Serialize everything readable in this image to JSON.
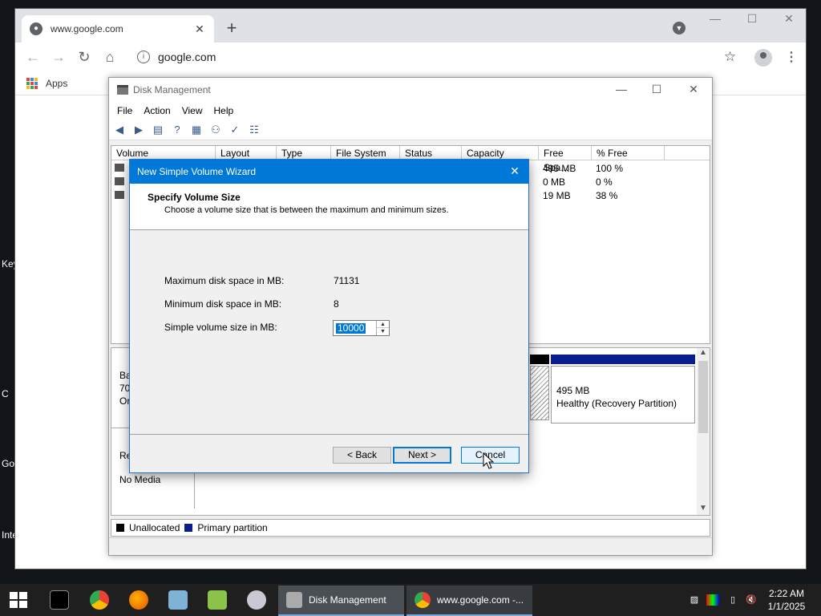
{
  "desktop": {
    "edge_labels": [
      "Key",
      "C",
      "Go",
      "Inte"
    ]
  },
  "browser": {
    "tab_title": "www.google.com",
    "url": "google.com",
    "bookmarks_label": "Apps",
    "icons": {
      "back": "back-arrow-icon",
      "forward": "forward-arrow-icon",
      "reload": "reload-icon",
      "home": "home-icon",
      "site_info": "info-icon",
      "bookmark": "star-icon",
      "profile": "avatar-icon",
      "menu": "kebab-menu-icon"
    }
  },
  "disk_mgmt": {
    "title": "Disk Management",
    "menu": [
      "File",
      "Action",
      "View",
      "Help"
    ],
    "columns": [
      "Volume",
      "Layout",
      "Type",
      "File System",
      "Status",
      "Capacity",
      "Free Spa...",
      "% Free"
    ],
    "rows": [
      {
        "free": "495 MB",
        "pct": "100 %"
      },
      {
        "free": "0 MB",
        "pct": "0 %"
      },
      {
        "free": "19 MB",
        "pct": "38 %"
      }
    ],
    "disk0": {
      "line1": "Ba",
      "line2": "70.",
      "line3": "Or"
    },
    "cdrom": {
      "line1": "Re",
      "line2": "No Media"
    },
    "recovery_partition": {
      "size": "495 MB",
      "label": "Healthy (Recovery Partition)"
    },
    "legend": [
      {
        "label": "Unallocated",
        "color": "#000000"
      },
      {
        "label": "Primary partition",
        "color": "#0a1d8f"
      }
    ]
  },
  "wizard": {
    "title": "New Simple Volume Wizard",
    "header_title": "Specify Volume Size",
    "header_subtitle": "Choose a volume size that is between the maximum and minimum sizes.",
    "max_label": "Maximum disk space in MB:",
    "max_value": "71131",
    "min_label": "Minimum disk space in MB:",
    "min_value": "8",
    "size_label": "Simple volume size in MB:",
    "size_value": "10000",
    "back_label": "< Back",
    "next_label": "Next >",
    "cancel_label": "Cancel"
  },
  "taskbar": {
    "tasks": [
      {
        "label": "Disk Management"
      },
      {
        "label": "www.google.com -..."
      }
    ],
    "time": "2:22 AM",
    "date": "1/1/2025"
  },
  "colors": {
    "accent": "#0078d7",
    "primary_partition": "#0a1d8f"
  }
}
